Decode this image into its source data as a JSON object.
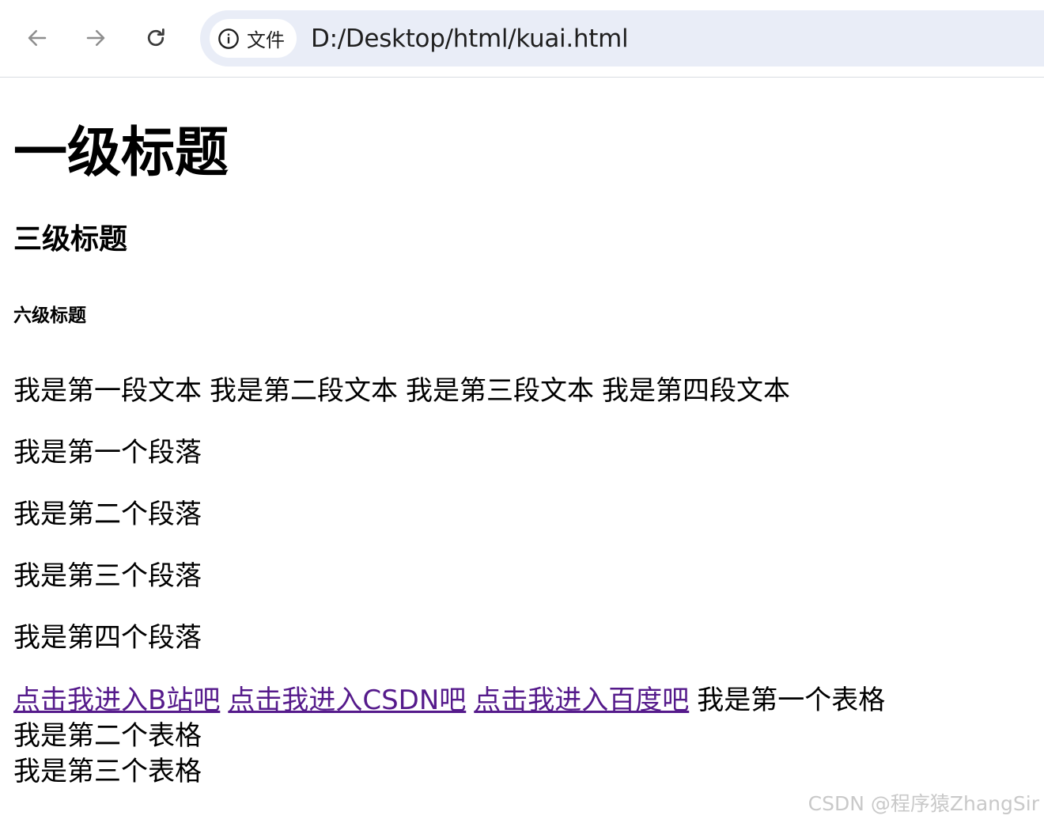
{
  "browser": {
    "icons": {
      "back": "arrow-left-icon",
      "forward": "arrow-right-icon",
      "reload": "reload-icon",
      "site_info": "info-circle-icon"
    },
    "site_chip_label": "文件",
    "url": "D:/Desktop/html/kuai.html",
    "colors": {
      "omnibox_bg": "#e9edf7",
      "chip_bg": "#ffffff",
      "icon_gray": "#8e8e8e",
      "icon_dark": "#3c3c3c"
    }
  },
  "page": {
    "h1": "一级标题",
    "h3": "三级标题",
    "h6": "六级标题",
    "texts": [
      "我是第一段文本",
      "我是第二段文本",
      "我是第三段文本",
      "我是第四段文本"
    ],
    "paragraphs": [
      "我是第一个段落",
      "我是第二个段落",
      "我是第三个段落",
      "我是第四个段落"
    ],
    "links": [
      "点击我进入B站吧",
      "点击我进入CSDN吧",
      "点击我进入百度吧"
    ],
    "link_color": "#551a8b",
    "tables": [
      "我是第一个表格",
      "我是第二个表格",
      "我是第三个表格"
    ]
  },
  "watermark": "CSDN @程序猿ZhangSir"
}
